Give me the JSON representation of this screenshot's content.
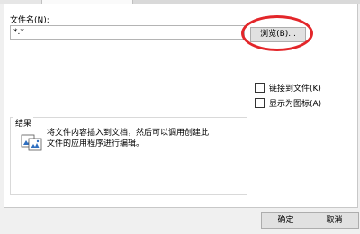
{
  "dialog": {
    "filename_label": "文件名(N):",
    "filename_value": "*.*",
    "browse_label": "浏览(B)...",
    "link_to_file_label": "链接到文件(K)",
    "display_as_icon_label": "显示为图标(A)",
    "result_title": "结果",
    "result_text_line1": "将文件内容插入到文档，然后可以调用创建此",
    "result_text_line2": "文件的应用程序进行编辑。",
    "ok_label": "确定",
    "cancel_label": "取消"
  },
  "colors": {
    "highlight": "#e3262a",
    "window_bg": "#f0f0f0",
    "panel_bg": "#ffffff"
  },
  "icons": {
    "result": "embedded-document-icon"
  }
}
